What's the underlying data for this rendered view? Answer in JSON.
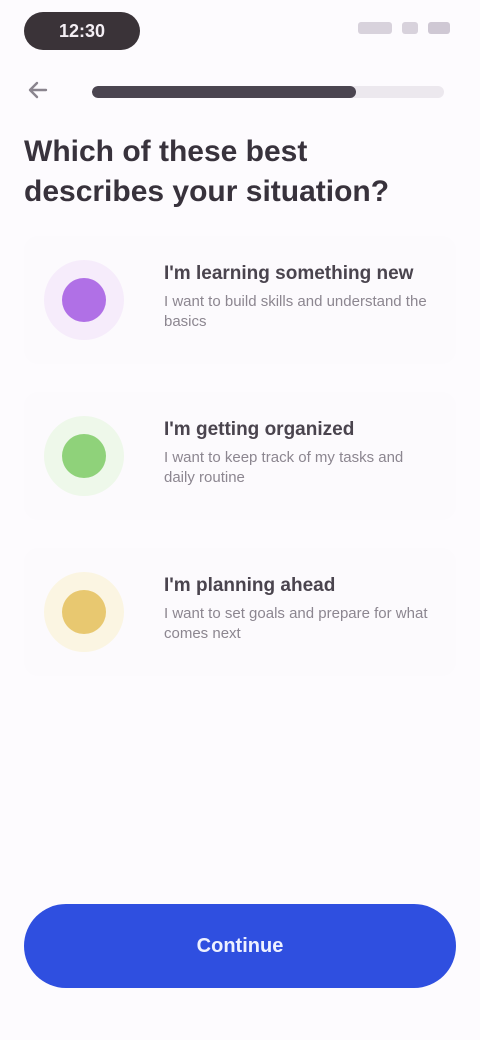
{
  "status": {
    "time": "12:30"
  },
  "header": {
    "progress": 0.75
  },
  "title": "Which of these best describes your situation?",
  "options": [
    {
      "title": "I'm learning something new",
      "desc": "I want to build skills and understand the basics",
      "accent": "#b070e6",
      "bg": "#f6ecfb"
    },
    {
      "title": "I'm getting organized",
      "desc": "I want to keep track of my tasks and daily routine",
      "accent": "#8fd27a",
      "bg": "#eef8ea"
    },
    {
      "title": "I'm planning ahead",
      "desc": "I want to set goals and prepare for what comes next",
      "accent": "#e8c870",
      "bg": "#fbf5e2"
    }
  ],
  "cta": {
    "label": "Continue"
  },
  "colors": {
    "primary": "#2f4fe0"
  }
}
